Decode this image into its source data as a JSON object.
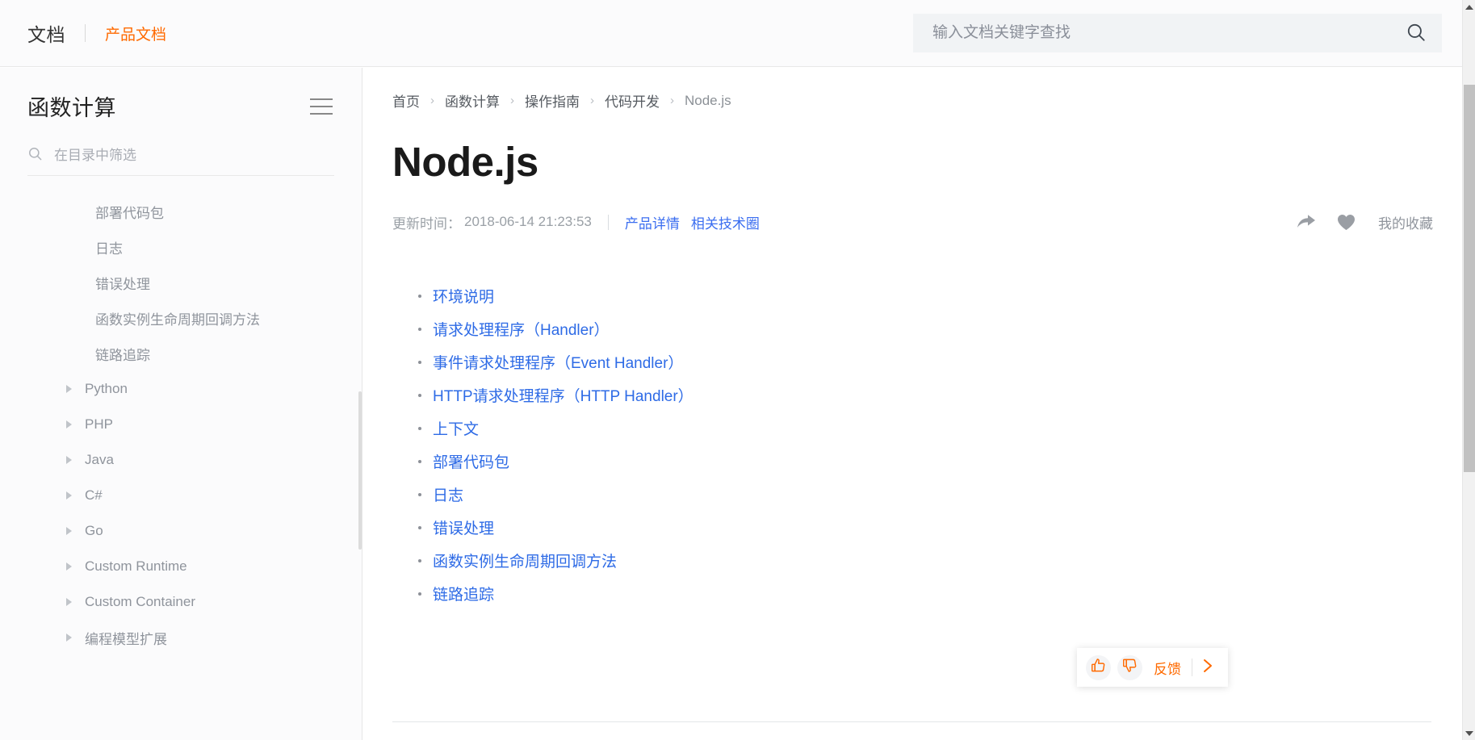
{
  "topbar": {
    "brand": "文档",
    "product": "产品文档",
    "search": {
      "placeholder": "输入文档关键字查找",
      "value": "",
      "icon": "search-icon"
    },
    "menu_icon": "hamburger-icon"
  },
  "sidebar": {
    "title": "函数计算",
    "menu_icon": "hamburger-icon",
    "filter": {
      "placeholder": "在目录中筛选",
      "value": "",
      "icon": "search-icon"
    },
    "leaf_items": [
      {
        "label": "部署代码包"
      },
      {
        "label": "日志"
      },
      {
        "label": "错误处理"
      },
      {
        "label": "函数实例生命周期回调方法"
      },
      {
        "label": "链路追踪"
      }
    ],
    "node_items": [
      {
        "label": "Python"
      },
      {
        "label": "PHP"
      },
      {
        "label": "Java"
      },
      {
        "label": "C#"
      },
      {
        "label": "Go"
      },
      {
        "label": "Custom Runtime"
      },
      {
        "label": "Custom Container"
      },
      {
        "label": "编程模型扩展"
      }
    ]
  },
  "main": {
    "breadcrumb": [
      {
        "label": "首页",
        "current": false
      },
      {
        "label": "函数计算",
        "current": false
      },
      {
        "label": "操作指南",
        "current": false
      },
      {
        "label": "代码开发",
        "current": false
      },
      {
        "label": "Node.js",
        "current": true
      }
    ],
    "breadcrumb_separator": "›",
    "title": "Node.js",
    "meta": {
      "updated_label": "更新时间：",
      "updated_time": "2018-06-14 21:23:53",
      "links": [
        "产品详情",
        "相关技术圈"
      ],
      "share_icon": "share-icon",
      "heart_icon": "heart-icon",
      "favorite_label": "我的收藏"
    },
    "toc": [
      "环境说明",
      "请求处理程序（Handler）",
      "事件请求处理程序（Event Handler）",
      "HTTP请求处理程序（HTTP Handler）",
      "上下文",
      "部署代码包",
      "日志",
      "错误处理",
      "函数实例生命周期回调方法",
      "链路追踪"
    ]
  },
  "feedback": {
    "like_icon": "thumbs-up-icon",
    "dislike_icon": "thumbs-down-icon",
    "label": "反馈",
    "expand_icon": "chevron-right-icon"
  },
  "colors": {
    "accent_orange": "#ff6a00",
    "link_blue": "#2e6be6",
    "meta_link_blue": "#3b6ef0",
    "text_primary": "#1a1a1a",
    "text_muted": "#8f949c",
    "panel_bg": "#fbfbfc",
    "search_bg": "#f1f3f5"
  },
  "scrollbars": {
    "page_thumb_position": "top",
    "sidebar_thumb_position": "middle"
  }
}
